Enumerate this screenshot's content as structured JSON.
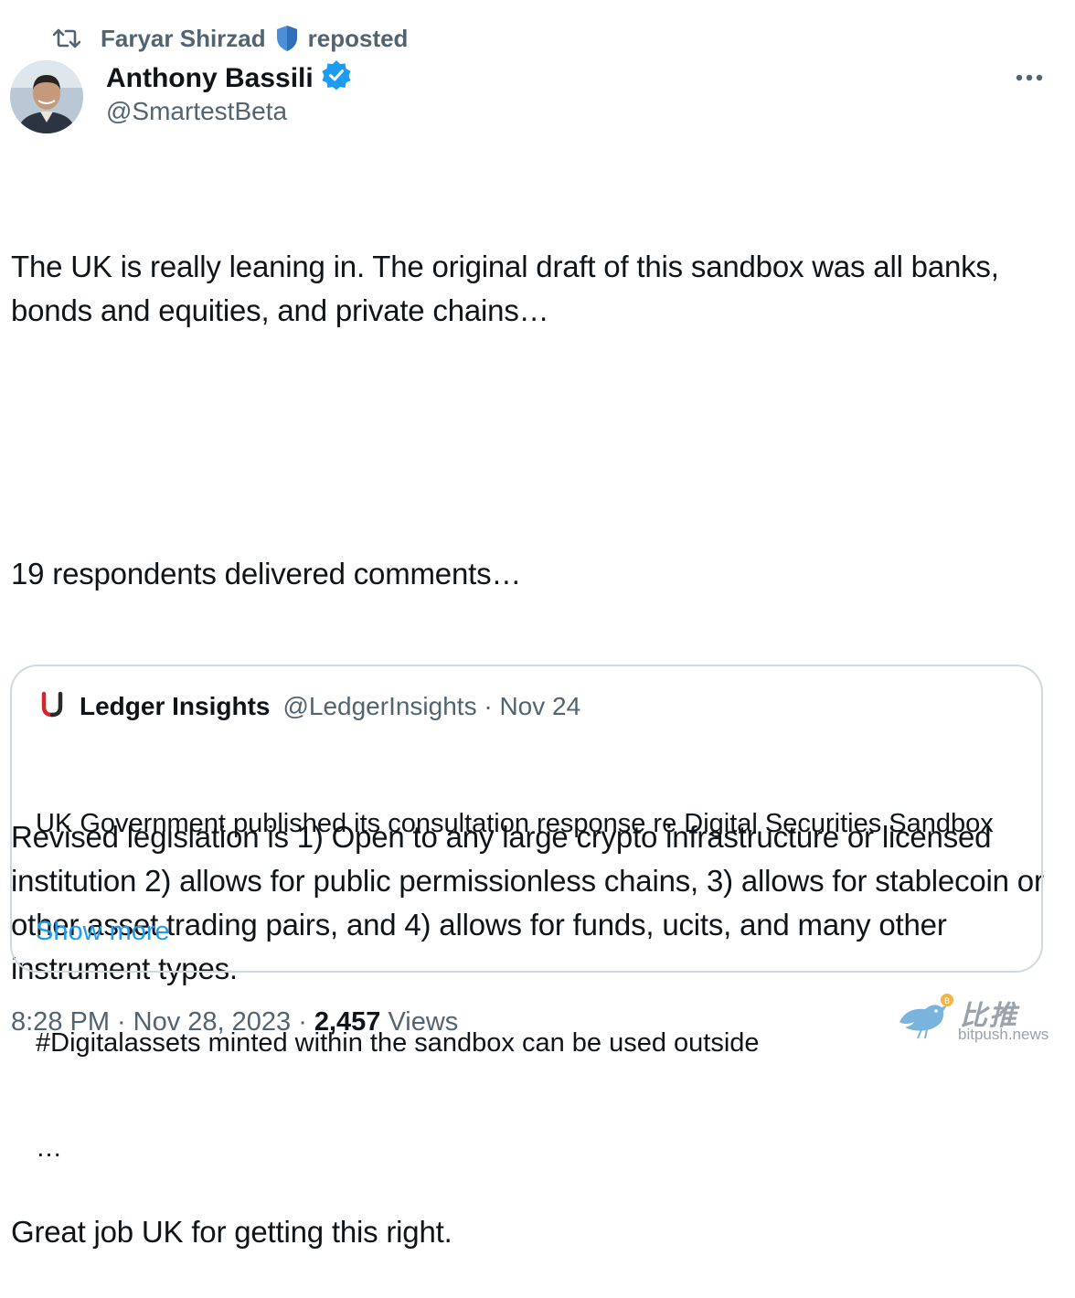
{
  "repost": {
    "icon": "repost-icon",
    "reposter_name": "Faryar Shirzad",
    "shield_icon": "shield-icon",
    "label": "reposted"
  },
  "author": {
    "name": "Anthony Bassili",
    "verified_icon": "verified-badge-icon",
    "handle": "@SmartestBeta"
  },
  "more_icon": "more-options-icon",
  "tweet": {
    "paragraphs": [
      "The UK is really leaning in. The original draft of this sandbox was all banks, bonds and equities, and private chains…",
      "19 respondents delivered comments…",
      "Revised legislation is 1) Open to any large crypto infrastructure or licensed institution 2) allows for public permissionless chains, 3) allows for stablecoin or other asset trading pairs, and 4) allows for funds, ucits, and many other instrument types.",
      "Great job UK for getting this right."
    ]
  },
  "quote": {
    "logo_icon": "ledger-insights-logo-icon",
    "name": "Ledger Insights",
    "handle_date": "@LedgerInsights · Nov 24",
    "text_lines": [
      "UK Government published its consultation response re Digital Securities Sandbox",
      "",
      "#Digitalassets minted within the sandbox can be used outside",
      "…"
    ],
    "show_more": "Show more"
  },
  "meta": {
    "time": "8:28 PM",
    "sep1": "·",
    "date": "Nov 28, 2023",
    "sep2": "·",
    "views_count": "2,457",
    "views_label": "Views"
  },
  "watermark": {
    "brand_cn": "比推",
    "domain": "bitpush.news"
  },
  "colors": {
    "text": "#0f1419",
    "secondary": "#536471",
    "accent": "#1d9bf0",
    "border": "#cfd9de"
  }
}
